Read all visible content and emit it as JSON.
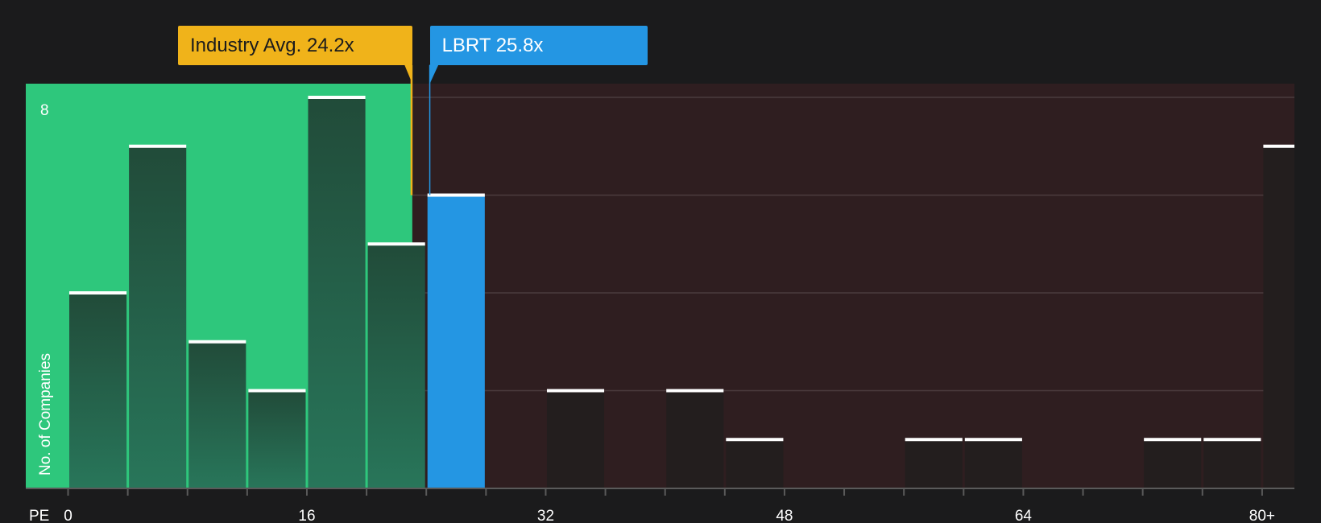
{
  "chart_data": {
    "type": "bar",
    "xlabel": "PE",
    "ylabel": "No. of Companies",
    "bin_width": 4,
    "x_ticks": [
      "0",
      "16",
      "32",
      "48",
      "64",
      "80+"
    ],
    "x_tick_values": [
      0,
      16,
      32,
      48,
      64,
      80
    ],
    "y_tick_label": "8",
    "ylim": [
      0,
      8
    ],
    "xlim": [
      -2.9,
      82
    ],
    "bins": [
      {
        "x0": 0,
        "value": 4
      },
      {
        "x0": 4,
        "value": 7
      },
      {
        "x0": 8,
        "value": 3
      },
      {
        "x0": 12,
        "value": 2
      },
      {
        "x0": 16,
        "value": 8
      },
      {
        "x0": 20,
        "value": 5
      },
      {
        "x0": 24,
        "value": 6,
        "highlight": true
      },
      {
        "x0": 28,
        "value": 0
      },
      {
        "x0": 32,
        "value": 2
      },
      {
        "x0": 36,
        "value": 0
      },
      {
        "x0": 40,
        "value": 2
      },
      {
        "x0": 44,
        "value": 1
      },
      {
        "x0": 48,
        "value": 0
      },
      {
        "x0": 52,
        "value": 0
      },
      {
        "x0": 56,
        "value": 1
      },
      {
        "x0": 60,
        "value": 1
      },
      {
        "x0": 64,
        "value": 0
      },
      {
        "x0": 68,
        "value": 0
      },
      {
        "x0": 72,
        "value": 1
      },
      {
        "x0": 76,
        "value": 1
      },
      {
        "x0": 80,
        "value": 7
      }
    ],
    "industry_avg": {
      "label": "Industry Avg. 24.2x",
      "value": 24.2,
      "color": "#f0b31a"
    },
    "company": {
      "label": "LBRT 25.8x",
      "value": 25.8,
      "color": "#2496e3"
    },
    "colors": {
      "background": "#1b1b1c",
      "undervalued_zone": "#2ec77c",
      "overvalued_zone": "#2f1e20",
      "bar_green_top": "#214b39",
      "bar_green_bottom": "#28765a",
      "bar_dark": "#231e1e",
      "bar_highlight": "#2496e3",
      "bar_cap": "#ffffff",
      "gridline": "#4a3b3d"
    }
  }
}
